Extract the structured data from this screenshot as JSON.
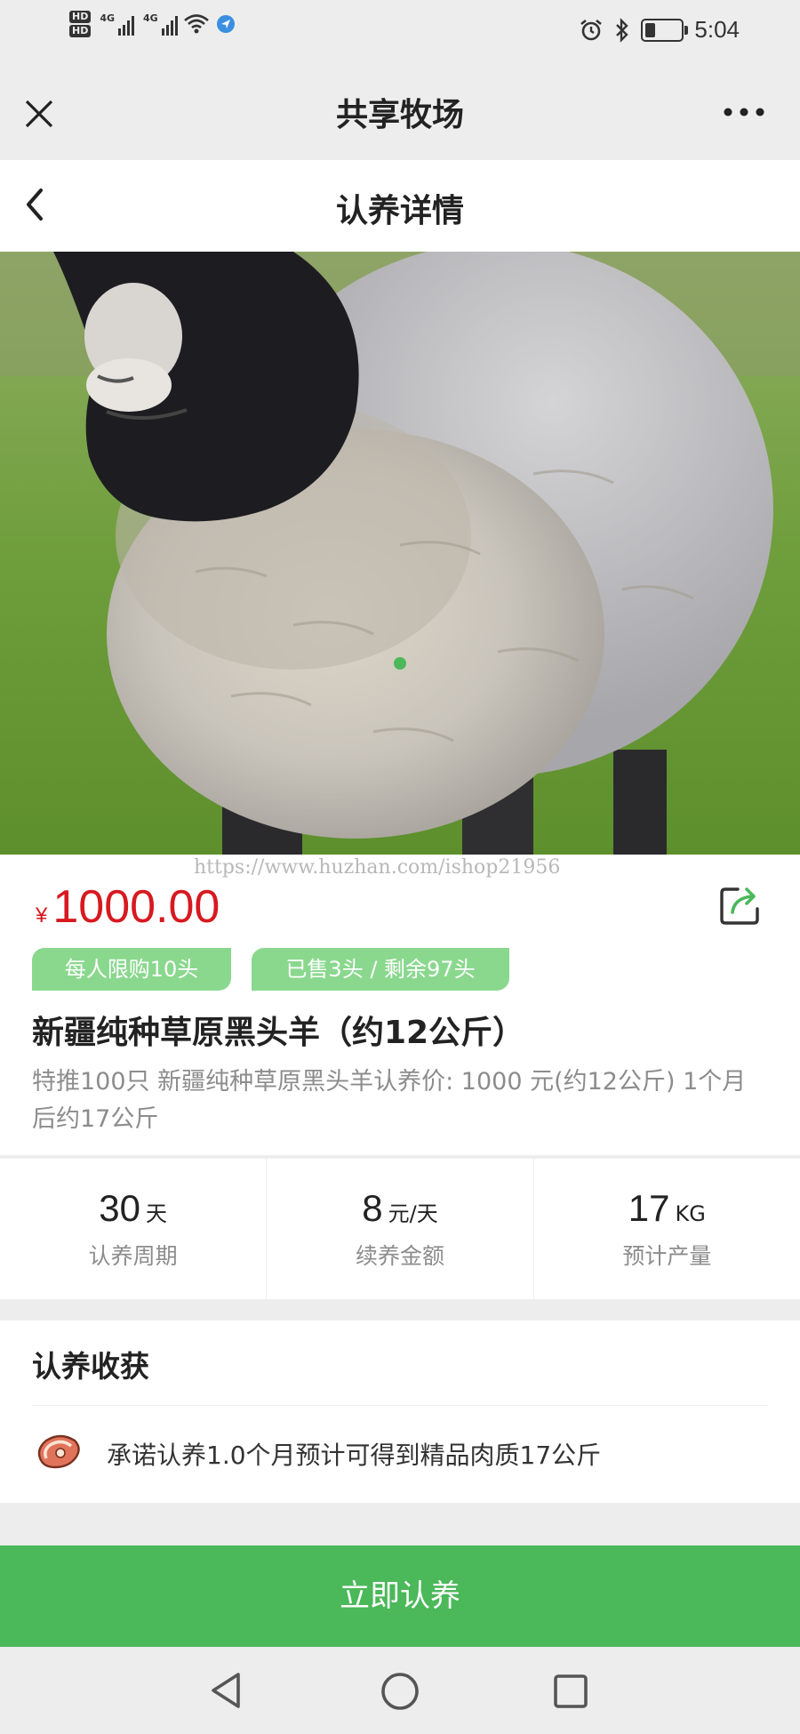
{
  "status_bar": {
    "hd_labels": [
      "HD",
      "HD"
    ],
    "sim_labels": [
      "4G",
      "4G"
    ],
    "time": "5:04",
    "battery_level": 0.3
  },
  "wechat_bar": {
    "title": "共享牧场",
    "close_icon": "close-icon",
    "more_icon": "more-icon"
  },
  "page_header": {
    "title": "认养详情",
    "back_icon": "back-icon"
  },
  "carousel": {
    "slide_count": 1,
    "active_index": 0,
    "indicator_color": "#4bb85a"
  },
  "watermark": "https://www.huzhan.com/ishop21956",
  "product": {
    "currency": "¥",
    "price": "1000.00",
    "share_icon": "share-icon",
    "tags": [
      {
        "label": "每人限购10头"
      },
      {
        "label": "已售3头 / 剩余97头"
      }
    ],
    "title": "新疆纯种草原黑头羊（约12公斤）",
    "description": "特推100只 新疆纯种草原黑头羊认养价: 1000 元(约12公斤) 1个月后约17公斤"
  },
  "stats": [
    {
      "value": "30",
      "unit": "天",
      "label": "认养周期"
    },
    {
      "value": "8",
      "unit": "元/天",
      "label": "续养金额"
    },
    {
      "value": "17",
      "unit": "KG",
      "label": "预计产量"
    }
  ],
  "harvest": {
    "title": "认养收获",
    "icon": "meat-icon",
    "text": "承诺认养1.0个月预计可得到精品肉质17公斤"
  },
  "cta": {
    "label": "立即认养"
  },
  "nav_bar": {
    "back": "nav-back-icon",
    "home": "nav-home-icon",
    "recents": "nav-recents-icon"
  },
  "colors": {
    "price_red": "#d71920",
    "tag_green": "#8ad88e",
    "button_green": "#4bb85a"
  }
}
